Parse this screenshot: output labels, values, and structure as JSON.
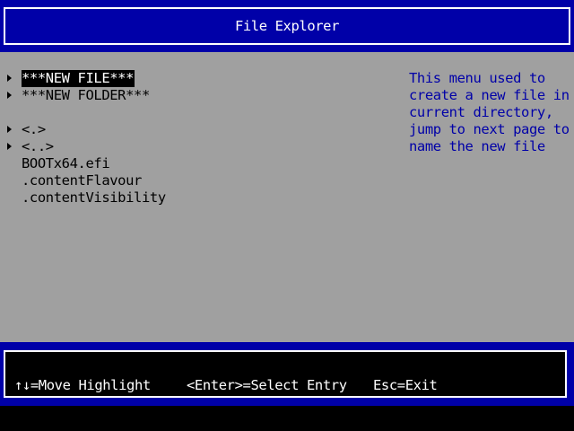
{
  "header": {
    "title": "File Explorer"
  },
  "menu": {
    "items": [
      {
        "label": "***NEW FILE***",
        "arrow": true,
        "highlighted": true
      },
      {
        "label": "***NEW FOLDER***",
        "arrow": true,
        "highlighted": false
      },
      {
        "label": "<.>",
        "arrow": true,
        "highlighted": false
      },
      {
        "label": "<..>",
        "arrow": true,
        "highlighted": false
      },
      {
        "label": "BOOTx64.efi",
        "arrow": false,
        "highlighted": false
      },
      {
        "label": ".contentFlavour",
        "arrow": false,
        "highlighted": false
      },
      {
        "label": ".contentVisibility",
        "arrow": false,
        "highlighted": false
      }
    ]
  },
  "help": {
    "lines": [
      "This menu used to",
      "create a new file in",
      "current directory,",
      "jump to next page to",
      "name the new file"
    ]
  },
  "footer": {
    "move_hint": "↑↓=Move Highlight",
    "select_hint": "<Enter>=Select Entry",
    "exit_hint": "Esc=Exit"
  },
  "colors": {
    "header_bg": "#0000a8",
    "body_bg": "#a0a0a0",
    "help_text": "#0000a8",
    "footer_bg": "#000000"
  }
}
